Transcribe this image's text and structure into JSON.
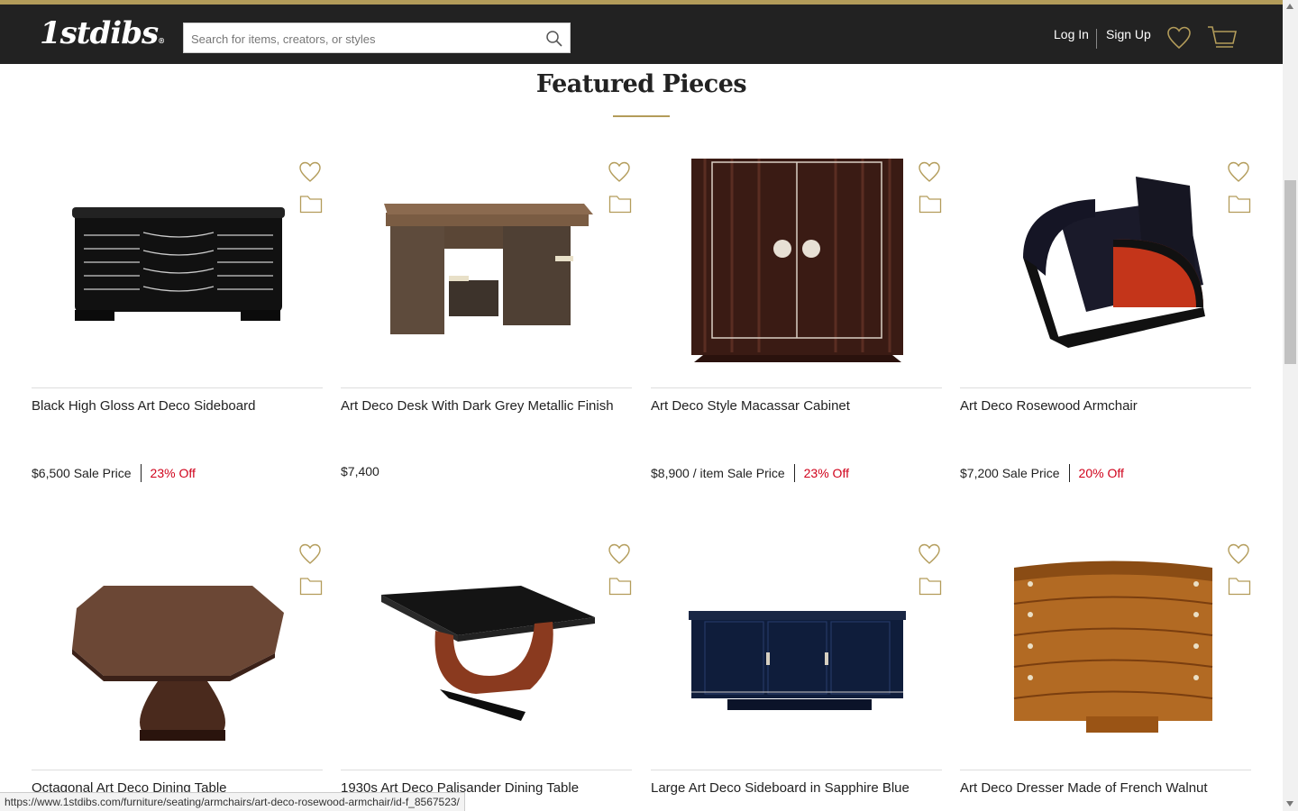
{
  "header": {
    "logo": "1stdibs",
    "logo_reg": "®",
    "search_placeholder": "Search for items, creators, or styles",
    "login_label": "Log In",
    "signup_label": "Sign Up",
    "accent_color": "#b39c5a"
  },
  "section": {
    "title": "Featured Pieces"
  },
  "products": [
    {
      "title": "Black High Gloss Art Deco Sideboard",
      "price": "$6,500 Sale Price",
      "discount": "23% Off"
    },
    {
      "title": "Art Deco Desk With Dark Grey Metallic Finish",
      "price": "$7,400",
      "discount": ""
    },
    {
      "title": "Art Deco Style Macassar Cabinet",
      "price": "$8,900 / item Sale Price",
      "discount": "23% Off"
    },
    {
      "title": "Art Deco Rosewood Armchair",
      "price": "$7,200 Sale Price",
      "discount": "20% Off"
    },
    {
      "title": "Octagonal Art Deco Dining Table",
      "price": "",
      "discount": ""
    },
    {
      "title": "1930s Art Deco Palisander Dining Table",
      "price": "",
      "discount": ""
    },
    {
      "title": "Large Art Deco Sideboard in Sapphire Blue",
      "price": "",
      "discount": ""
    },
    {
      "title": "Art Deco Dresser Made of French Walnut",
      "price": "",
      "discount": ""
    }
  ],
  "status_url": "https://www.1stdibs.com/furniture/seating/armchairs/art-deco-rosewood-armchair/id-f_8567523/",
  "icons": [
    "search-icon",
    "heart-icon",
    "cart-icon",
    "folder-icon"
  ]
}
